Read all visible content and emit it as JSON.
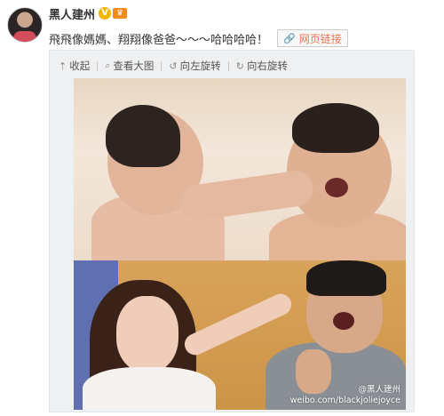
{
  "post": {
    "username": "黑人建州",
    "verified_badge": "V",
    "crown_badge": "♛",
    "text": "飛飛像媽媽、翔翔像爸爸～～～哈哈哈哈！",
    "weblink_label": "网页链接"
  },
  "toolbar": {
    "collapse_label": "收起",
    "view_large_label": "查看大图",
    "rotate_left_label": "向左旋转",
    "rotate_right_label": "向右旋转"
  },
  "photo": {
    "watermark_handle": "@黑人建州",
    "watermark_url": "weibo.com/blackjoliejoyce"
  }
}
